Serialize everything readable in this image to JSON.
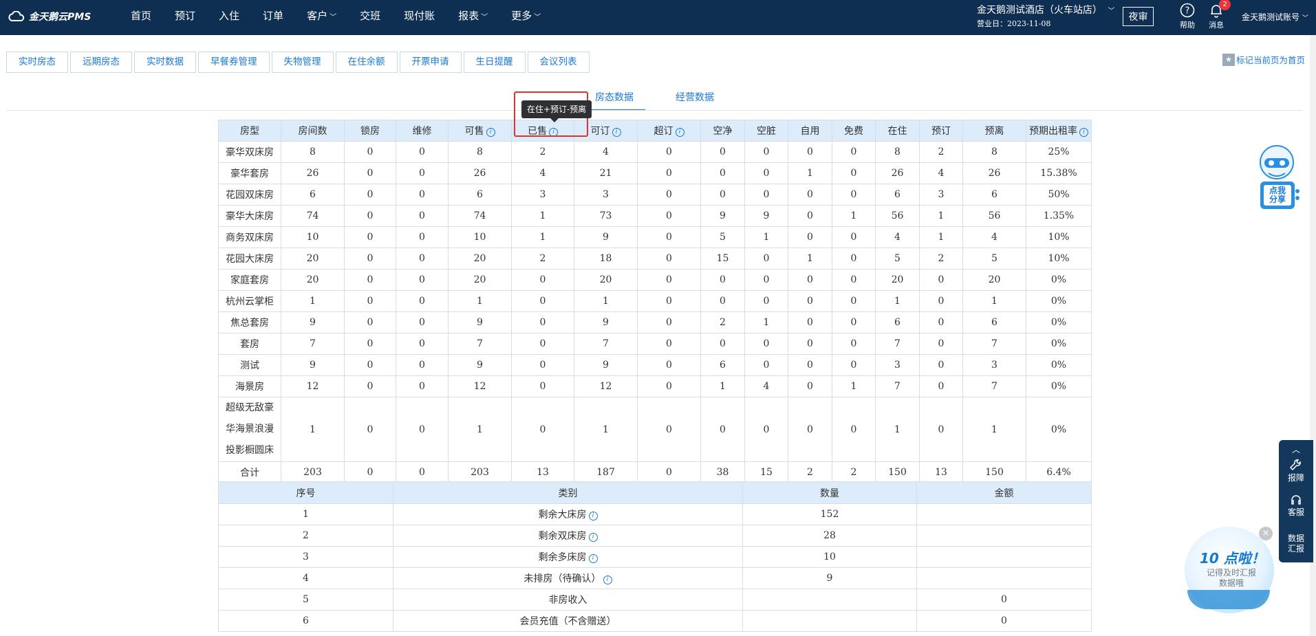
{
  "app": {
    "logo_text": "金天鹅云PMS"
  },
  "nav": {
    "items": [
      {
        "label": "首页",
        "has_menu": false
      },
      {
        "label": "预订",
        "has_menu": false
      },
      {
        "label": "入住",
        "has_menu": false
      },
      {
        "label": "订单",
        "has_menu": false
      },
      {
        "label": "客户",
        "has_menu": true
      },
      {
        "label": "交班",
        "has_menu": false
      },
      {
        "label": "现付账",
        "has_menu": false
      },
      {
        "label": "报表",
        "has_menu": true
      },
      {
        "label": "更多",
        "has_menu": true
      }
    ]
  },
  "header": {
    "hotel_name": "金天鹅测试酒店（火车站店）",
    "business_date": "营业日：2023-11-08",
    "night_audit": "夜审",
    "help": "帮助",
    "messages": "消息",
    "message_count": "2",
    "account": "金天鹅测试账号"
  },
  "subtabs": [
    "实时房态",
    "远期房态",
    "实时数据",
    "早餐券管理",
    "失物管理",
    "在住余额",
    "开票申请",
    "生日提醒",
    "会议列表"
  ],
  "pin_home": "标记当前页为首页",
  "view_tabs": {
    "room_status": "房态数据",
    "business": "经营数据",
    "active": "房态数据"
  },
  "tooltip": "在住+预订-预离",
  "room_table": {
    "headers": [
      {
        "label": "房型",
        "info": false
      },
      {
        "label": "房间数",
        "info": false
      },
      {
        "label": "锁房",
        "info": false
      },
      {
        "label": "维修",
        "info": false
      },
      {
        "label": "可售",
        "info": true
      },
      {
        "label": "已售",
        "info": true
      },
      {
        "label": "可订",
        "info": true
      },
      {
        "label": "超订",
        "info": true
      },
      {
        "label": "空净",
        "info": false
      },
      {
        "label": "空脏",
        "info": false
      },
      {
        "label": "自用",
        "info": false
      },
      {
        "label": "免费",
        "info": false
      },
      {
        "label": "在住",
        "info": false
      },
      {
        "label": "预订",
        "info": false
      },
      {
        "label": "预离",
        "info": false
      },
      {
        "label": "预期出租率",
        "info": true
      }
    ],
    "rows": [
      [
        "豪华双床房",
        "8",
        "0",
        "0",
        "8",
        "2",
        "4",
        "0",
        "0",
        "0",
        "0",
        "0",
        "8",
        "2",
        "8",
        "25%"
      ],
      [
        "豪华套房",
        "26",
        "0",
        "0",
        "26",
        "4",
        "21",
        "0",
        "0",
        "0",
        "1",
        "0",
        "26",
        "4",
        "26",
        "15.38%"
      ],
      [
        "花园双床房",
        "6",
        "0",
        "0",
        "6",
        "3",
        "3",
        "0",
        "0",
        "0",
        "0",
        "0",
        "6",
        "3",
        "6",
        "50%"
      ],
      [
        "豪华大床房",
        "74",
        "0",
        "0",
        "74",
        "1",
        "73",
        "0",
        "9",
        "9",
        "0",
        "1",
        "56",
        "1",
        "56",
        "1.35%"
      ],
      [
        "商务双床房",
        "10",
        "0",
        "0",
        "10",
        "1",
        "9",
        "0",
        "5",
        "1",
        "0",
        "0",
        "4",
        "1",
        "4",
        "10%"
      ],
      [
        "花园大床房",
        "20",
        "0",
        "0",
        "20",
        "2",
        "18",
        "0",
        "15",
        "0",
        "1",
        "0",
        "5",
        "2",
        "5",
        "10%"
      ],
      [
        "家庭套房",
        "20",
        "0",
        "0",
        "20",
        "0",
        "20",
        "0",
        "0",
        "0",
        "0",
        "0",
        "20",
        "0",
        "20",
        "0%"
      ],
      [
        "杭州云掌柜",
        "1",
        "0",
        "0",
        "1",
        "0",
        "1",
        "0",
        "0",
        "0",
        "0",
        "0",
        "1",
        "0",
        "1",
        "0%"
      ],
      [
        "焦总套房",
        "9",
        "0",
        "0",
        "9",
        "0",
        "9",
        "0",
        "2",
        "1",
        "0",
        "0",
        "6",
        "0",
        "6",
        "0%"
      ],
      [
        "套房",
        "7",
        "0",
        "0",
        "7",
        "0",
        "7",
        "0",
        "0",
        "0",
        "0",
        "0",
        "7",
        "0",
        "7",
        "0%"
      ],
      [
        "测试",
        "9",
        "0",
        "0",
        "9",
        "0",
        "9",
        "0",
        "6",
        "0",
        "0",
        "0",
        "3",
        "0",
        "3",
        "0%"
      ],
      [
        "海景房",
        "12",
        "0",
        "0",
        "12",
        "0",
        "12",
        "0",
        "1",
        "4",
        "0",
        "1",
        "7",
        "0",
        "7",
        "0%"
      ],
      [
        "超级无敌豪华海景浪漫投影橱圆床",
        "1",
        "0",
        "0",
        "1",
        "0",
        "1",
        "0",
        "0",
        "0",
        "0",
        "0",
        "1",
        "0",
        "1",
        "0%"
      ],
      [
        "合计",
        "203",
        "0",
        "0",
        "203",
        "13",
        "187",
        "0",
        "38",
        "15",
        "2",
        "2",
        "150",
        "13",
        "150",
        "6.4%"
      ]
    ]
  },
  "summary_table": {
    "headers": [
      "序号",
      "类别",
      "数量",
      "金额"
    ],
    "rows": [
      {
        "no": "1",
        "category": "剩余大床房",
        "info": true,
        "qty": "152",
        "amount": ""
      },
      {
        "no": "2",
        "category": "剩余双床房",
        "info": true,
        "qty": "28",
        "amount": ""
      },
      {
        "no": "3",
        "category": "剩余多床房",
        "info": true,
        "qty": "10",
        "amount": ""
      },
      {
        "no": "4",
        "category": "未排房（待确认）",
        "info": true,
        "qty": "9",
        "amount": ""
      },
      {
        "no": "5",
        "category": "非房收入",
        "info": false,
        "qty": "",
        "amount": "0"
      },
      {
        "no": "6",
        "category": "会员充值（不含赠送）",
        "info": false,
        "qty": "",
        "amount": "0"
      }
    ]
  },
  "side_panel": {
    "report_issue": "报障",
    "customer_service": "客服",
    "data_report": "数据汇报"
  },
  "mascot_text": "点我分享",
  "promo": {
    "title": "10 点啦！",
    "subtitle": "记得及时汇报数据哦"
  },
  "colors": {
    "nav_bg": "#0f2f52",
    "accent": "#1a7ad6",
    "header_bg": "#dcecfa",
    "highlight": "#e2322c"
  }
}
